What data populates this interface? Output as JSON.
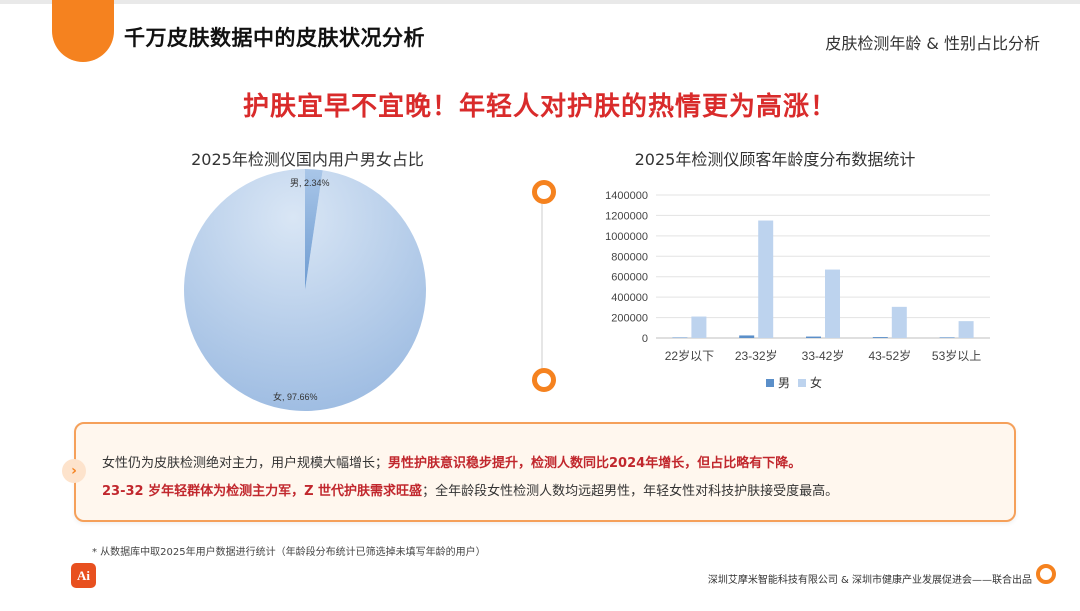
{
  "header": {
    "main_title": "千万皮肤数据中的皮肤状况分析",
    "section_title": "皮肤检测年龄 & 性别占比分析"
  },
  "headline": "护肤宜早不宜晚！年轻人对护肤的热情更为高涨！",
  "pie": {
    "title": "2025年检测仪国内用户男女占比",
    "label_male": "男, 2.34%",
    "label_female": "女, 97.66%"
  },
  "bar": {
    "title": "2025年检测仪顾客年龄度分布数据统计",
    "legend_male": "男",
    "legend_female": "女"
  },
  "chart_data": [
    {
      "type": "pie",
      "title": "2025年检测仪国内用户男女占比",
      "categories": [
        "男",
        "女"
      ],
      "values": [
        2.34,
        97.66
      ],
      "colors": [
        "#7ba7d8",
        "#b3cdea"
      ]
    },
    {
      "type": "bar",
      "title": "2025年检测仪顾客年龄度分布数据统计",
      "categories": [
        "22岁以下",
        "23-32岁",
        "33-42岁",
        "43-52岁",
        "53岁以上"
      ],
      "series": [
        {
          "name": "男",
          "values": [
            5000,
            25000,
            14000,
            9000,
            6000
          ],
          "color": "#5b8fc9"
        },
        {
          "name": "女",
          "values": [
            210000,
            1150000,
            670000,
            305000,
            165000
          ],
          "color": "#bdd3ee"
        }
      ],
      "ylim": [
        0,
        1400000
      ],
      "yticks": [
        0,
        200000,
        400000,
        600000,
        800000,
        1000000,
        1200000,
        1400000
      ],
      "grid": true,
      "legend": "bottom"
    }
  ],
  "callout": {
    "line1_normal": "女性仍为皮肤检测绝对主力，用户规模大幅增长；",
    "line1_red": "男性护肤意识稳步提升，检测人数同比2024年增长，但占比略有下降。",
    "line2_red": "23-32 岁年轻群体为检测主力军，Z 世代护肤需求旺盛",
    "line2_normal": "；全年龄段女性检测人数均远超男性，年轻女性对科技护肤接受度最高。"
  },
  "footnote": "* 从数据库中取2025年用户数据进行统计（年龄段分布统计已筛选掉未填写年龄的用户）",
  "credit": "深圳艾摩米智能科技有限公司 & 深圳市健康产业发展促进会——联合出品",
  "logo_text": "Ai",
  "colors": {
    "accent": "#f5821f",
    "headline_red": "#d92b2b"
  }
}
